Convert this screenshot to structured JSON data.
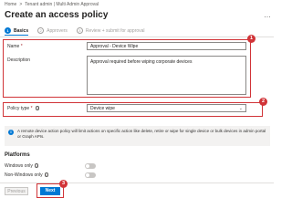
{
  "breadcrumb": [
    "Home",
    "Tenant admin | Multi Admin Approval"
  ],
  "page_title": "Create an access policy",
  "more_icon": "ellipsis-icon",
  "tabs": [
    {
      "num": "1",
      "label": "Basics"
    },
    {
      "num": "2",
      "label": "Approvers"
    },
    {
      "num": "3",
      "label": "Review + submit for approval"
    }
  ],
  "form": {
    "name_label": "Name",
    "name_value": "Approval - Device Wipe",
    "description_label": "Description",
    "description_value": "Approval required before wiping corporate devices",
    "policy_type_label": "Policy type",
    "policy_type_value": "Device wipe",
    "required_mark": "*"
  },
  "info_text": "A remote device action policy will limit actions on specific action like delete, retire or wipe for single device or bulk devices in admin portal or Graph APIs.",
  "platforms": {
    "title": "Platforms",
    "rows": [
      {
        "label": "Windows only"
      },
      {
        "label": "Non-Windows only"
      }
    ]
  },
  "footer": {
    "previous_label": "Previous",
    "next_label": "Next"
  },
  "callouts": [
    "1",
    "2",
    "3"
  ],
  "colors": {
    "accent": "#0078d4",
    "callout": "#d13438"
  }
}
